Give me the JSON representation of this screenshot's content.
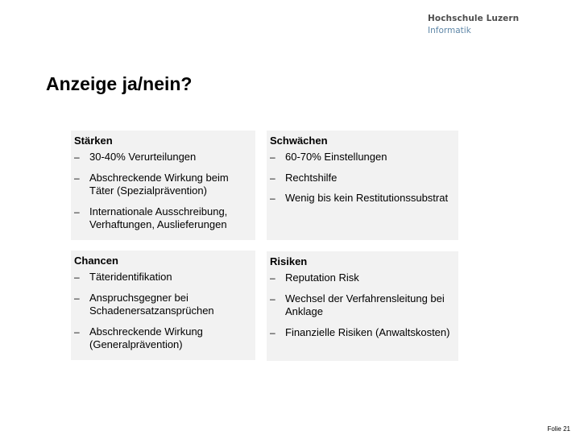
{
  "logo": {
    "line1": "Hochschule Luzern",
    "line2": "Informatik"
  },
  "slide": {
    "title": "Anzeige ja/nein?",
    "footer": "Folie 21"
  },
  "quadrants": {
    "strengths": {
      "title": "Stärken",
      "items": [
        "30-40% Verurteilungen",
        "Abschreckende Wirkung beim Täter (Spezialprävention)",
        "Internationale Ausschreibung, Verhaftungen, Auslieferungen"
      ]
    },
    "weaknesses": {
      "title": "Schwächen",
      "items": [
        "60-70% Einstellungen",
        "Rechtshilfe",
        "Wenig bis kein Restitutionssubstrat"
      ]
    },
    "opportunities": {
      "title": "Chancen",
      "items": [
        "Täteridentifikation",
        "Anspruchsgegner bei Schadenersatzansprüchen",
        "Abschreckende Wirkung (Generalprävention)"
      ]
    },
    "risks": {
      "title": "Risiken",
      "items": [
        "Reputation Risk",
        "Wechsel der Verfahrensleitung bei Anklage",
        "Finanzielle Risiken (Anwaltskosten)"
      ]
    }
  },
  "bullet_glyph": "–",
  "colors": {
    "box_background": "#f2f2f2",
    "logo_primary": "#4d4d4d",
    "logo_secondary": "#5f87a8"
  }
}
